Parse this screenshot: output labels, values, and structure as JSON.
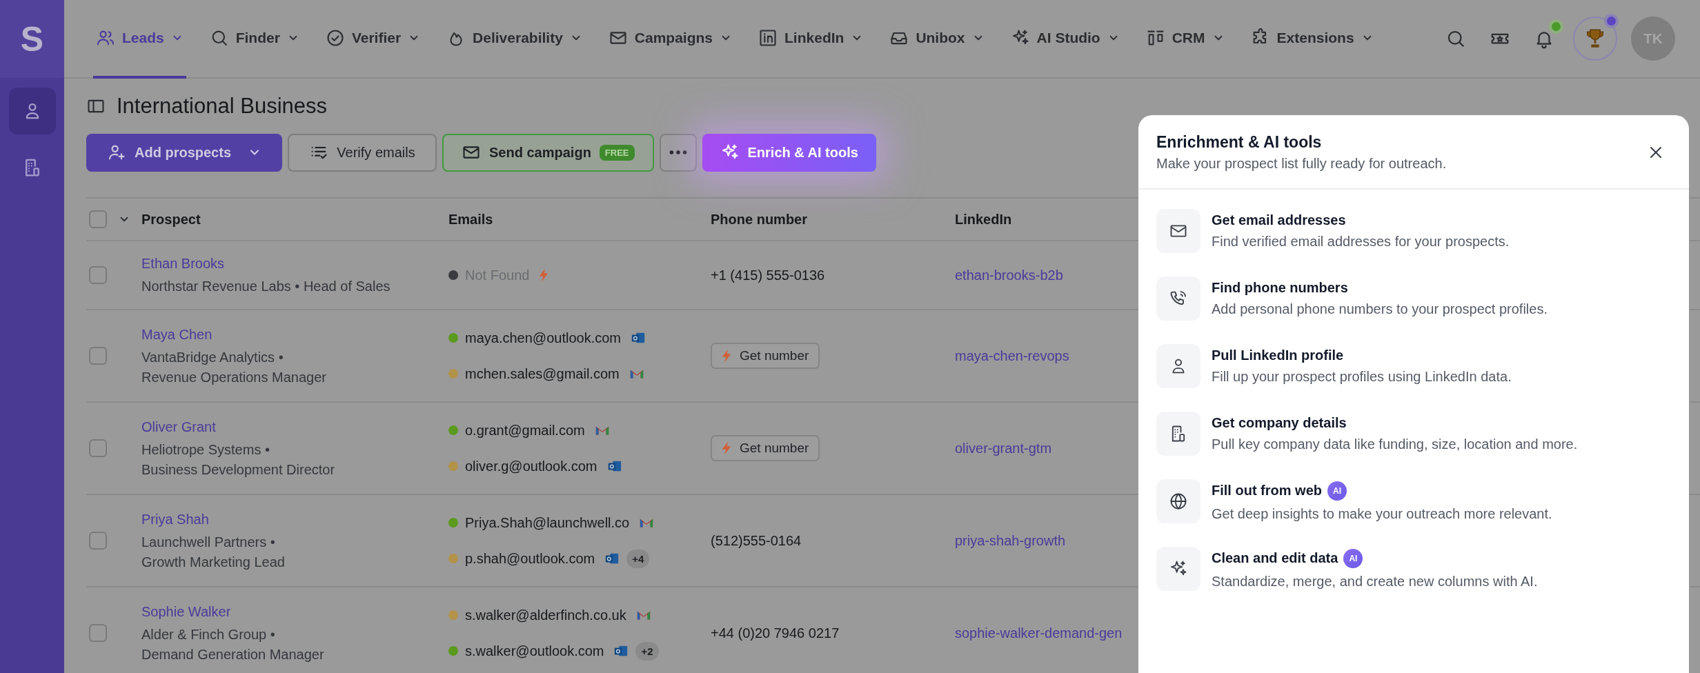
{
  "sidebar": {
    "logo": "S",
    "items": [
      {
        "selected": true
      },
      {
        "selected": false
      }
    ]
  },
  "nav": {
    "items": [
      {
        "label": "Leads",
        "selected": true
      },
      {
        "label": "Finder",
        "selected": false
      },
      {
        "label": "Verifier",
        "selected": false
      },
      {
        "label": "Deliverability",
        "selected": false
      },
      {
        "label": "Campaigns",
        "selected": false
      },
      {
        "label": "LinkedIn",
        "selected": false
      },
      {
        "label": "Unibox",
        "selected": false
      },
      {
        "label": "AI Studio",
        "selected": false
      },
      {
        "label": "CRM",
        "selected": false
      },
      {
        "label": "Extensions",
        "selected": false
      }
    ],
    "actions": [
      {
        "kind": "search"
      },
      {
        "kind": "ticket"
      },
      {
        "kind": "bell",
        "color": "#4a9a2a"
      },
      {
        "kind": "trophy",
        "color": "#5b45c0"
      }
    ],
    "avatar": "TK"
  },
  "page_title": "International Business",
  "toolbar": [
    {
      "kind": "primary",
      "label": "Add prospects"
    },
    {
      "kind": "outline",
      "label": "Verify emails"
    },
    {
      "kind": "campaign",
      "label": "Send campaign",
      "badge": "FREE"
    },
    {
      "kind": "more"
    },
    {
      "kind": "ai",
      "label": "Enrich & AI tools"
    }
  ],
  "table": {
    "select_all_checked": false,
    "columns": [
      "Prospect",
      "Emails",
      "Phone number",
      "LinkedIn"
    ],
    "rows": [
      {
        "checked": false,
        "name": "Ethan Brooks",
        "details": [
          "Northstar Revenue Labs • Head of Sales"
        ],
        "emails": [
          {
            "address": "Not Found",
            "kind": "not_found",
            "color": "#3a3c40"
          }
        ],
        "phone": "+1 (415) 555-0136",
        "linkedin": "ethan-brooks-b2b"
      },
      {
        "checked": false,
        "name": "Maya Chen",
        "details": [
          "VantaBridge Analytics •",
          "Revenue Operations Manager"
        ],
        "emails": [
          {
            "address": "maya.chen@outlook.com",
            "kind": "outlook",
            "color": "#5a9a1e"
          },
          {
            "address": "mchen.sales@gmail.com",
            "kind": "gmail",
            "color": "#b3924a"
          }
        ],
        "phone_button": "Get number",
        "linkedin": "maya-chen-revops"
      },
      {
        "checked": false,
        "name": "Oliver Grant",
        "details": [
          "Heliotrope Systems •",
          "Business Development Director"
        ],
        "emails": [
          {
            "address": "o.grant@gmail.com",
            "kind": "gmail",
            "color": "#5a9a1e"
          },
          {
            "address": "oliver.g@outlook.com",
            "kind": "outlook",
            "color": "#b3924a"
          }
        ],
        "phone_button": "Get number",
        "linkedin": "oliver-grant-gtm"
      },
      {
        "checked": false,
        "name": "Priya Shah",
        "details": [
          "Launchwell Partners •",
          "Growth Marketing Lead"
        ],
        "emails": [
          {
            "address": "Priya.Shah@launchwell.co",
            "kind": "gmail",
            "color": "#5a9a1e"
          },
          {
            "address": "p.shah@outlook.com",
            "kind": "outlook",
            "color": "#b3924a",
            "more": "+4"
          }
        ],
        "phone": "(512)555-0164",
        "linkedin": "priya-shah-growth"
      },
      {
        "checked": false,
        "name": "Sophie Walker",
        "details": [
          "Alder & Finch Group •",
          "Demand Generation Manager"
        ],
        "emails": [
          {
            "address": "s.walker@alderfinch.co.uk",
            "kind": "gmail",
            "color": "#b3924a"
          },
          {
            "address": "s.walker@outlook.com",
            "kind": "outlook",
            "color": "#5a9a1e",
            "more": "+2"
          }
        ],
        "phone": "+44 (0)20 7946 0217",
        "linkedin": "sophie-walker-demand-gen"
      }
    ]
  },
  "panel": {
    "title": "Enrichment & AI tools",
    "subtitle": "Make your prospect list fully ready for outreach.",
    "items": [
      {
        "title": "Get email addresses",
        "description": "Find verified email addresses for your prospects."
      },
      {
        "title": "Find phone numbers",
        "description": "Add personal phone numbers to your prospect profiles."
      },
      {
        "title": "Pull LinkedIn profile",
        "description": "Fill up your prospect profiles using LinkedIn data."
      },
      {
        "title": "Get company details",
        "description": "Pull key company data like funding, size, location and more."
      },
      {
        "title": "Fill out from web",
        "badge": "AI",
        "description": "Get deep insights to make your outreach more relevant."
      },
      {
        "title": "Clean and edit data",
        "badge": "AI",
        "description": "Standardize, merge, and create new columns with AI."
      }
    ]
  }
}
